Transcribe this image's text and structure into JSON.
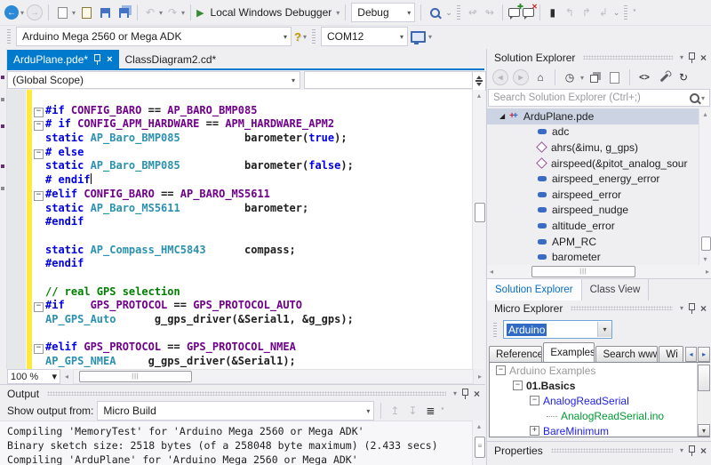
{
  "glyphs": {
    "back": "←",
    "forward": "→",
    "dropdown": "▾",
    "play": "▶",
    "undo": "↶",
    "redo": "↷",
    "home": "⌂",
    "clock": "◷",
    "sync": "↻",
    "view_code": "<>",
    "bookmark": "▮",
    "bookmark_prev": "↰",
    "bookmark_next": "↱",
    "bookmark_clear": "↲",
    "navigate_back": "↫",
    "navigate_fwd": "↬",
    "up": "▴",
    "down": "▾",
    "left": "◂",
    "right": "▸",
    "help": "?",
    "overflow": "⌄",
    "more": "”",
    "close": "×",
    "minus": "−",
    "plus": "+",
    "expanded": "◢",
    "comment_add_mark": "✚",
    "comment_del_mark": "✕",
    "hgrip": "|||",
    "vgrip_thumb": "≡",
    "out_prev": "↥",
    "out_next": "↧",
    "out_clear": "≣"
  },
  "colors": {
    "accent": "#007acc",
    "selection": "#ccd3e2",
    "macro": "#70008c",
    "type": "#2b91af",
    "keyword": "#0000e6",
    "comment": "#008000",
    "changed_bar": "#ffe93e"
  },
  "toolbar_main": {
    "debug_button": "Local Windows Debugger",
    "config_select": "Debug"
  },
  "toolbar_board": {
    "board_select": "Arduino Mega 2560 or Mega ADK",
    "port_select": "COM12"
  },
  "tabs": {
    "active": "ArduPlane.pde*",
    "inactive": "ClassDiagram2.cd*"
  },
  "navbar": {
    "scope": "(Global Scope)"
  },
  "editor": {
    "zoom": "100 %",
    "code_lines": [
      {
        "tokens": []
      },
      {
        "fold": true,
        "tokens": [
          {
            "c": "dir",
            "s": "#if "
          },
          {
            "c": "mac",
            "s": "CONFIG_BARO"
          },
          {
            "c": "pln",
            "s": " == "
          },
          {
            "c": "mac",
            "s": "AP_BARO_BMP085"
          }
        ]
      },
      {
        "fold": true,
        "tokens": [
          {
            "c": "dir",
            "s": "# if "
          },
          {
            "c": "mac",
            "s": "CONFIG_APM_HARDWARE"
          },
          {
            "c": "pln",
            "s": " == "
          },
          {
            "c": "mac",
            "s": "APM_HARDWARE_APM2"
          }
        ]
      },
      {
        "tokens": [
          {
            "c": "dir",
            "s": "static "
          },
          {
            "c": "typ",
            "s": "AP_Baro_BMP085"
          },
          {
            "c": "pln",
            "s": "          barometer("
          },
          {
            "c": "dir",
            "s": "true"
          },
          {
            "c": "pln",
            "s": ");"
          }
        ]
      },
      {
        "fold": true,
        "tokens": [
          {
            "c": "dir",
            "s": "# else"
          }
        ]
      },
      {
        "tokens": [
          {
            "c": "dir",
            "s": "static "
          },
          {
            "c": "typ",
            "s": "AP_Baro_BMP085"
          },
          {
            "c": "pln",
            "s": "          barometer("
          },
          {
            "c": "dir",
            "s": "false"
          },
          {
            "c": "pln",
            "s": ");"
          }
        ]
      },
      {
        "caret": true,
        "tokens": [
          {
            "c": "dir",
            "s": "# endif"
          }
        ]
      },
      {
        "fold": true,
        "tokens": [
          {
            "c": "dir",
            "s": "#elif "
          },
          {
            "c": "mac",
            "s": "CONFIG_BARO"
          },
          {
            "c": "pln",
            "s": " == "
          },
          {
            "c": "mac",
            "s": "AP_BARO_MS5611"
          }
        ]
      },
      {
        "tokens": [
          {
            "c": "dir",
            "s": "static "
          },
          {
            "c": "typ",
            "s": "AP_Baro_MS5611"
          },
          {
            "c": "pln",
            "s": "          barometer;"
          }
        ]
      },
      {
        "tokens": [
          {
            "c": "dir",
            "s": "#endif"
          }
        ]
      },
      {
        "tokens": []
      },
      {
        "tokens": [
          {
            "c": "dir",
            "s": "static "
          },
          {
            "c": "typ",
            "s": "AP_Compass_HMC5843"
          },
          {
            "c": "pln",
            "s": "      compass;"
          }
        ]
      },
      {
        "tokens": [
          {
            "c": "dir",
            "s": "#endif"
          }
        ]
      },
      {
        "tokens": []
      },
      {
        "tokens": [
          {
            "c": "cmt",
            "s": "// real GPS selection"
          }
        ]
      },
      {
        "fold": true,
        "tokens": [
          {
            "c": "dir",
            "s": "#if    "
          },
          {
            "c": "mac",
            "s": "GPS_PROTOCOL"
          },
          {
            "c": "pln",
            "s": " == "
          },
          {
            "c": "mac",
            "s": "GPS_PROTOCOL_AUTO"
          }
        ]
      },
      {
        "tokens": [
          {
            "c": "typ",
            "s": "AP_GPS_Auto"
          },
          {
            "c": "pln",
            "s": "      g_gps_driver(&Serial1, &g_gps);"
          }
        ]
      },
      {
        "tokens": []
      },
      {
        "fold": true,
        "tokens": [
          {
            "c": "dir",
            "s": "#elif "
          },
          {
            "c": "mac",
            "s": "GPS_PROTOCOL"
          },
          {
            "c": "pln",
            "s": " == "
          },
          {
            "c": "mac",
            "s": "GPS_PROTOCOL_NMEA"
          }
        ]
      },
      {
        "tokens": [
          {
            "c": "typ",
            "s": "AP_GPS_NMEA"
          },
          {
            "c": "pln",
            "s": "     g_gps_driver(&Serial1);"
          }
        ]
      }
    ]
  },
  "solution_explorer": {
    "title": "Solution Explorer",
    "search_placeholder": "Search Solution Explorer (Ctrl+;)",
    "root": "ArduPlane.pde",
    "items": [
      {
        "icon": "field",
        "label": "adc"
      },
      {
        "icon": "method",
        "label": "ahrs(&imu, g_gps)"
      },
      {
        "icon": "method",
        "label": "airspeed(&pitot_analog_sour"
      },
      {
        "icon": "field",
        "label": "airspeed_energy_error"
      },
      {
        "icon": "field",
        "label": "airspeed_error"
      },
      {
        "icon": "field",
        "label": "airspeed_nudge"
      },
      {
        "icon": "field",
        "label": "altitude_error"
      },
      {
        "icon": "field",
        "label": "APM_RC"
      },
      {
        "icon": "field",
        "label": "barometer"
      }
    ],
    "bottom_tabs": [
      "Solution Explorer",
      "Class View"
    ]
  },
  "micro_explorer": {
    "title": "Micro Explorer",
    "platform_select": "Arduino",
    "tabs": [
      "Reference",
      "Examples",
      "Search www",
      "Wi"
    ],
    "tree": [
      {
        "label": "Arduino Examples",
        "depth": 0,
        "exp": "minus",
        "color": "gray"
      },
      {
        "label": "01.Basics",
        "depth": 1,
        "exp": "minus",
        "color": "black",
        "bold": true
      },
      {
        "label": "AnalogReadSerial",
        "depth": 2,
        "exp": "minus",
        "color": "blue"
      },
      {
        "label": "AnalogReadSerial.ino",
        "depth": 3,
        "color": "green"
      },
      {
        "label": "BareMinimum",
        "depth": 2,
        "exp": "plus",
        "color": "blue"
      }
    ]
  },
  "properties": {
    "title": "Properties"
  },
  "output": {
    "title": "Output",
    "show_output_from_label": "Show output from:",
    "source_select": "Micro Build",
    "lines": [
      "Compiling 'MemoryTest' for 'Arduino Mega 2560 or Mega ADK'",
      "Binary sketch size: 2518 bytes (of a 258048 byte maximum) (2.433 secs)",
      "Compiling 'ArduPlane' for 'Arduino Mega 2560 or Mega ADK'"
    ]
  }
}
